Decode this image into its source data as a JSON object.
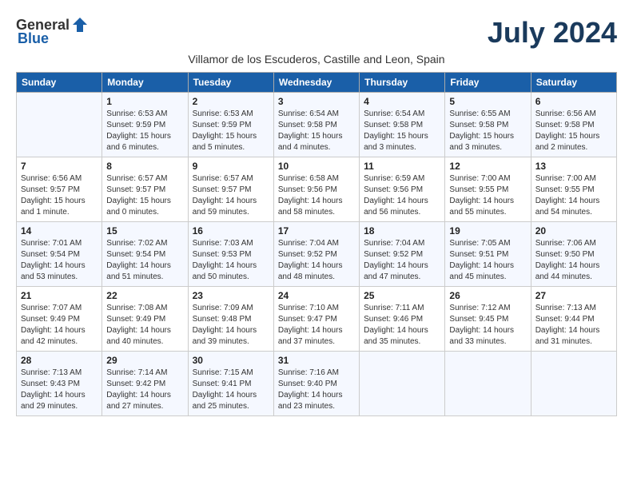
{
  "logo": {
    "general": "General",
    "blue": "Blue"
  },
  "title": "July 2024",
  "subtitle": "Villamor de los Escuderos, Castille and Leon, Spain",
  "days_of_week": [
    "Sunday",
    "Monday",
    "Tuesday",
    "Wednesday",
    "Thursday",
    "Friday",
    "Saturday"
  ],
  "weeks": [
    [
      {
        "day": "",
        "sunrise": "",
        "sunset": "",
        "daylight": ""
      },
      {
        "day": "1",
        "sunrise": "Sunrise: 6:53 AM",
        "sunset": "Sunset: 9:59 PM",
        "daylight": "Daylight: 15 hours and 6 minutes."
      },
      {
        "day": "2",
        "sunrise": "Sunrise: 6:53 AM",
        "sunset": "Sunset: 9:59 PM",
        "daylight": "Daylight: 15 hours and 5 minutes."
      },
      {
        "day": "3",
        "sunrise": "Sunrise: 6:54 AM",
        "sunset": "Sunset: 9:58 PM",
        "daylight": "Daylight: 15 hours and 4 minutes."
      },
      {
        "day": "4",
        "sunrise": "Sunrise: 6:54 AM",
        "sunset": "Sunset: 9:58 PM",
        "daylight": "Daylight: 15 hours and 3 minutes."
      },
      {
        "day": "5",
        "sunrise": "Sunrise: 6:55 AM",
        "sunset": "Sunset: 9:58 PM",
        "daylight": "Daylight: 15 hours and 3 minutes."
      },
      {
        "day": "6",
        "sunrise": "Sunrise: 6:56 AM",
        "sunset": "Sunset: 9:58 PM",
        "daylight": "Daylight: 15 hours and 2 minutes."
      }
    ],
    [
      {
        "day": "7",
        "sunrise": "Sunrise: 6:56 AM",
        "sunset": "Sunset: 9:57 PM",
        "daylight": "Daylight: 15 hours and 1 minute."
      },
      {
        "day": "8",
        "sunrise": "Sunrise: 6:57 AM",
        "sunset": "Sunset: 9:57 PM",
        "daylight": "Daylight: 15 hours and 0 minutes."
      },
      {
        "day": "9",
        "sunrise": "Sunrise: 6:57 AM",
        "sunset": "Sunset: 9:57 PM",
        "daylight": "Daylight: 14 hours and 59 minutes."
      },
      {
        "day": "10",
        "sunrise": "Sunrise: 6:58 AM",
        "sunset": "Sunset: 9:56 PM",
        "daylight": "Daylight: 14 hours and 58 minutes."
      },
      {
        "day": "11",
        "sunrise": "Sunrise: 6:59 AM",
        "sunset": "Sunset: 9:56 PM",
        "daylight": "Daylight: 14 hours and 56 minutes."
      },
      {
        "day": "12",
        "sunrise": "Sunrise: 7:00 AM",
        "sunset": "Sunset: 9:55 PM",
        "daylight": "Daylight: 14 hours and 55 minutes."
      },
      {
        "day": "13",
        "sunrise": "Sunrise: 7:00 AM",
        "sunset": "Sunset: 9:55 PM",
        "daylight": "Daylight: 14 hours and 54 minutes."
      }
    ],
    [
      {
        "day": "14",
        "sunrise": "Sunrise: 7:01 AM",
        "sunset": "Sunset: 9:54 PM",
        "daylight": "Daylight: 14 hours and 53 minutes."
      },
      {
        "day": "15",
        "sunrise": "Sunrise: 7:02 AM",
        "sunset": "Sunset: 9:54 PM",
        "daylight": "Daylight: 14 hours and 51 minutes."
      },
      {
        "day": "16",
        "sunrise": "Sunrise: 7:03 AM",
        "sunset": "Sunset: 9:53 PM",
        "daylight": "Daylight: 14 hours and 50 minutes."
      },
      {
        "day": "17",
        "sunrise": "Sunrise: 7:04 AM",
        "sunset": "Sunset: 9:52 PM",
        "daylight": "Daylight: 14 hours and 48 minutes."
      },
      {
        "day": "18",
        "sunrise": "Sunrise: 7:04 AM",
        "sunset": "Sunset: 9:52 PM",
        "daylight": "Daylight: 14 hours and 47 minutes."
      },
      {
        "day": "19",
        "sunrise": "Sunrise: 7:05 AM",
        "sunset": "Sunset: 9:51 PM",
        "daylight": "Daylight: 14 hours and 45 minutes."
      },
      {
        "day": "20",
        "sunrise": "Sunrise: 7:06 AM",
        "sunset": "Sunset: 9:50 PM",
        "daylight": "Daylight: 14 hours and 44 minutes."
      }
    ],
    [
      {
        "day": "21",
        "sunrise": "Sunrise: 7:07 AM",
        "sunset": "Sunset: 9:49 PM",
        "daylight": "Daylight: 14 hours and 42 minutes."
      },
      {
        "day": "22",
        "sunrise": "Sunrise: 7:08 AM",
        "sunset": "Sunset: 9:49 PM",
        "daylight": "Daylight: 14 hours and 40 minutes."
      },
      {
        "day": "23",
        "sunrise": "Sunrise: 7:09 AM",
        "sunset": "Sunset: 9:48 PM",
        "daylight": "Daylight: 14 hours and 39 minutes."
      },
      {
        "day": "24",
        "sunrise": "Sunrise: 7:10 AM",
        "sunset": "Sunset: 9:47 PM",
        "daylight": "Daylight: 14 hours and 37 minutes."
      },
      {
        "day": "25",
        "sunrise": "Sunrise: 7:11 AM",
        "sunset": "Sunset: 9:46 PM",
        "daylight": "Daylight: 14 hours and 35 minutes."
      },
      {
        "day": "26",
        "sunrise": "Sunrise: 7:12 AM",
        "sunset": "Sunset: 9:45 PM",
        "daylight": "Daylight: 14 hours and 33 minutes."
      },
      {
        "day": "27",
        "sunrise": "Sunrise: 7:13 AM",
        "sunset": "Sunset: 9:44 PM",
        "daylight": "Daylight: 14 hours and 31 minutes."
      }
    ],
    [
      {
        "day": "28",
        "sunrise": "Sunrise: 7:13 AM",
        "sunset": "Sunset: 9:43 PM",
        "daylight": "Daylight: 14 hours and 29 minutes."
      },
      {
        "day": "29",
        "sunrise": "Sunrise: 7:14 AM",
        "sunset": "Sunset: 9:42 PM",
        "daylight": "Daylight: 14 hours and 27 minutes."
      },
      {
        "day": "30",
        "sunrise": "Sunrise: 7:15 AM",
        "sunset": "Sunset: 9:41 PM",
        "daylight": "Daylight: 14 hours and 25 minutes."
      },
      {
        "day": "31",
        "sunrise": "Sunrise: 7:16 AM",
        "sunset": "Sunset: 9:40 PM",
        "daylight": "Daylight: 14 hours and 23 minutes."
      },
      {
        "day": "",
        "sunrise": "",
        "sunset": "",
        "daylight": ""
      },
      {
        "day": "",
        "sunrise": "",
        "sunset": "",
        "daylight": ""
      },
      {
        "day": "",
        "sunrise": "",
        "sunset": "",
        "daylight": ""
      }
    ]
  ]
}
